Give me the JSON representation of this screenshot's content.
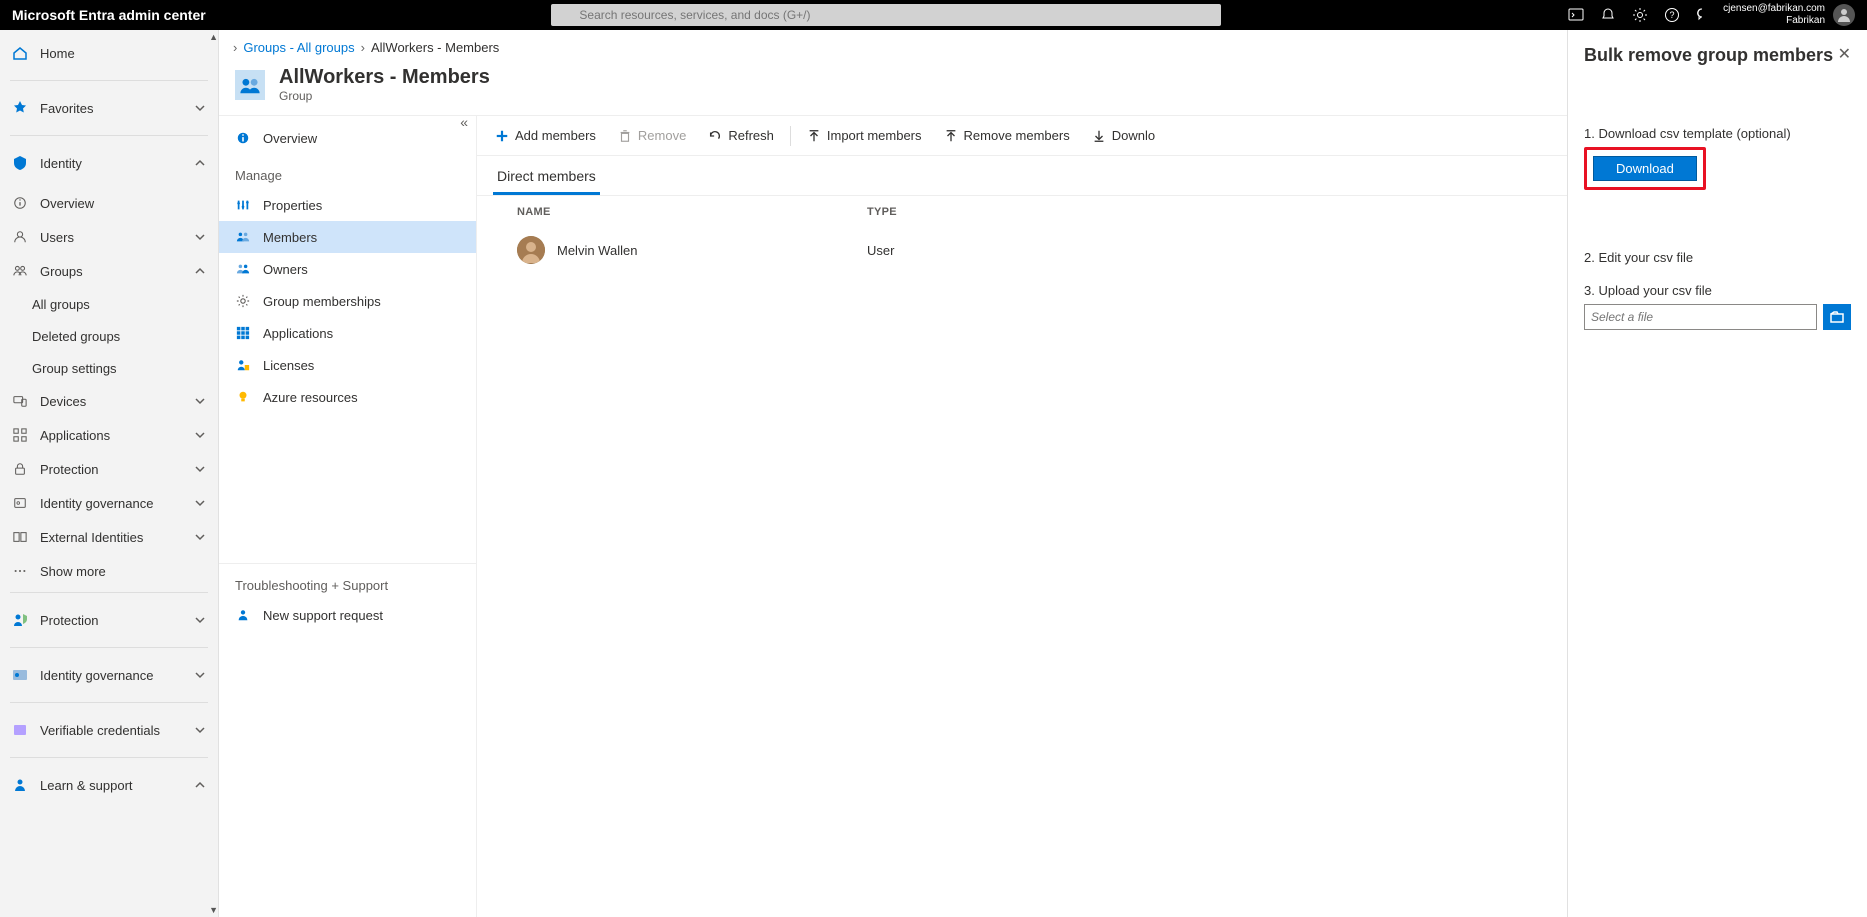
{
  "brand": "Microsoft Entra admin center",
  "search_placeholder": "Search resources, services, and docs (G+/)",
  "account": {
    "email": "cjensen@fabrikan.com",
    "tenant": "Fabrikan"
  },
  "left_nav": {
    "home": "Home",
    "favorites": "Favorites",
    "identity": "Identity",
    "identity_items": {
      "overview": "Overview",
      "users": "Users",
      "groups": "Groups",
      "groups_sub": {
        "all": "All groups",
        "deleted": "Deleted groups",
        "settings": "Group settings"
      },
      "devices": "Devices",
      "applications": "Applications",
      "protection": "Protection",
      "idgov": "Identity governance",
      "external": "External Identities",
      "showmore": "Show more"
    },
    "sections": {
      "protection": "Protection",
      "idgov": "Identity governance",
      "verifiable": "Verifiable credentials",
      "learn": "Learn & support"
    }
  },
  "breadcrumb": {
    "groups": "Groups - All groups",
    "current": "AllWorkers - Members"
  },
  "page": {
    "title": "AllWorkers - Members",
    "subtitle": "Group"
  },
  "resmenu": {
    "overview": "Overview",
    "manage": "Manage",
    "properties": "Properties",
    "members": "Members",
    "owners": "Owners",
    "groupmem": "Group memberships",
    "applications": "Applications",
    "licenses": "Licenses",
    "azure": "Azure resources",
    "trouble": "Troubleshooting + Support",
    "support": "New support request"
  },
  "toolbar": {
    "add": "Add members",
    "remove": "Remove",
    "refresh": "Refresh",
    "import": "Import members",
    "removebulk": "Remove members",
    "download": "Downlo"
  },
  "tabs": {
    "direct": "Direct members"
  },
  "grid": {
    "headers": {
      "name": "NAME",
      "type": "TYPE"
    },
    "rows": [
      {
        "name": "Melvin Wallen",
        "type": "User"
      }
    ]
  },
  "flyout": {
    "title": "Bulk remove group members",
    "step1": "1. Download csv template (optional)",
    "download": "Download",
    "step2": "2. Edit your csv file",
    "step3": "3. Upload your csv file",
    "file_placeholder": "Select a file"
  }
}
